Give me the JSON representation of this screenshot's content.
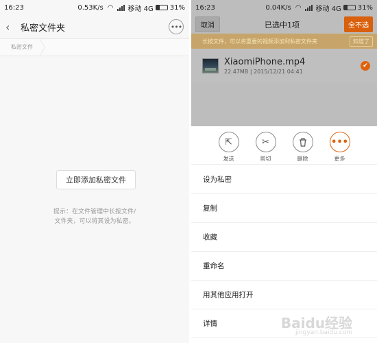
{
  "left": {
    "status": {
      "time": "16:23",
      "speed": "0.53K/s",
      "network": "移动 4G",
      "battery": "31%"
    },
    "header": {
      "back_icon": "‹",
      "title": "私密文件夹",
      "more_icon": "•••"
    },
    "breadcrumb": "私密文件",
    "add_button": "立即添加私密文件",
    "hint_line1": "提示：在文件管理中长按文件/",
    "hint_line2": "文件夹，可以将其设为私密。"
  },
  "right": {
    "status": {
      "time": "16:23",
      "speed": "0.04K/s",
      "network": "移动 4G",
      "battery": "31%"
    },
    "header": {
      "cancel": "取消",
      "title": "已选中1项",
      "deselect_all": "全不选"
    },
    "tip": {
      "text": "长按文件，可以将重要的视频添加到私密文件夹",
      "button": "知道了"
    },
    "file": {
      "name": "XiaomiPhone.mp4",
      "meta": "22.47MB  |  2015/12/21 04:41",
      "checked": true
    },
    "actions": [
      {
        "icon": "share-icon",
        "glyph": "⇱",
        "label": "发送"
      },
      {
        "icon": "scissors-icon",
        "glyph": "✂",
        "label": "剪切"
      },
      {
        "icon": "trash-icon",
        "glyph": "🗑",
        "label": "删除"
      },
      {
        "icon": "more-icon",
        "glyph": "•••",
        "label": "更多"
      }
    ],
    "menu": [
      "设为私密",
      "复制",
      "收藏",
      "重命名",
      "用其他应用打开",
      "详情"
    ]
  },
  "watermark": {
    "text": "Baidu经验",
    "sub": "jingyan.baidu.com"
  },
  "colors": {
    "accent": "#e0620b",
    "tip_bg": "#c7a56a",
    "dim_bg": "#bdbdbd"
  }
}
